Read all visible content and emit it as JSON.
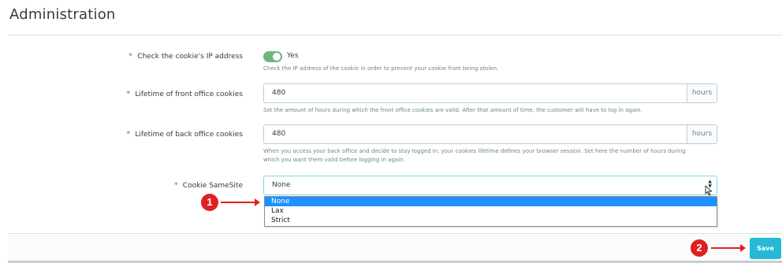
{
  "page": {
    "title": "Administration"
  },
  "form": {
    "ip_check": {
      "label": "Check the cookie's IP address",
      "required_mark": "*",
      "toggle_value": "Yes",
      "help": "Check the IP address of the cookie in order to prevent your cookie from being stolen."
    },
    "front_lifetime": {
      "label": "Lifetime of front office cookies",
      "required_mark": "*",
      "value": "480",
      "unit": "hours",
      "help": "Set the amount of hours during which the front office cookies are valid. After that amount of time, the customer will have to log in again."
    },
    "back_lifetime": {
      "label": "Lifetime of back office cookies",
      "required_mark": "*",
      "value": "480",
      "unit": "hours",
      "help_line1": "When you access your back office and decide to stay logged in, your cookies lifetime defines your browser session. Set here the number of hours during",
      "help_line2": "which you want them valid before logging in again."
    },
    "samesite": {
      "label": "Cookie SameSite",
      "required_mark": "*",
      "selected": "None",
      "options": [
        "None",
        "Lax",
        "Strict"
      ]
    }
  },
  "footer": {
    "save_label": "Save"
  },
  "annotations": {
    "badge1": "1",
    "badge2": "2",
    "color": "#e02020"
  },
  "icons": {
    "select_arrows": "updown-arrows-icon",
    "cursor": "mouse-pointer-icon"
  }
}
